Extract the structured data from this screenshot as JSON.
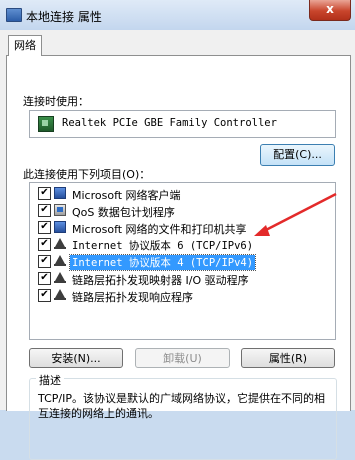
{
  "window": {
    "title": "本地连接 属性",
    "close_label": "x"
  },
  "tabs": [
    {
      "label": "网络",
      "active": true
    }
  ],
  "connect_using": {
    "label": "连接时使用：",
    "adapter": "Realtek PCIe GBE Family Controller",
    "configure_label": "配置(C)..."
  },
  "items": {
    "label": "此连接使用下列项目(O)：",
    "list": [
      {
        "label": "Microsoft 网络客户端",
        "checked": true,
        "icon": "network-client-icon"
      },
      {
        "label": "QoS 数据包计划程序",
        "checked": true,
        "icon": "qos-icon"
      },
      {
        "label": "Microsoft 网络的文件和打印机共享",
        "checked": true,
        "icon": "network-share-icon"
      },
      {
        "label": "Internet 协议版本 6 (TCP/IPv6)",
        "checked": true,
        "icon": "protocol-icon"
      },
      {
        "label": "Internet 协议版本 4 (TCP/IPv4)",
        "checked": true,
        "icon": "protocol-icon",
        "selected": true
      },
      {
        "label": "链路层拓扑发现映射器 I/O 驱动程序",
        "checked": true,
        "icon": "protocol-icon"
      },
      {
        "label": "链路层拓扑发现响应程序",
        "checked": true,
        "icon": "protocol-icon"
      }
    ]
  },
  "buttons": {
    "install": "安装(N)...",
    "uninstall": "卸载(U)",
    "properties": "属性(R)"
  },
  "description": {
    "legend": "描述",
    "text": "TCP/IP。该协议是默认的广域网络协议，它提供在不同的相互连接的网络上的通讯。"
  },
  "colors": {
    "selection": "#3399ff",
    "annotation_arrow": "#e32a2a"
  }
}
